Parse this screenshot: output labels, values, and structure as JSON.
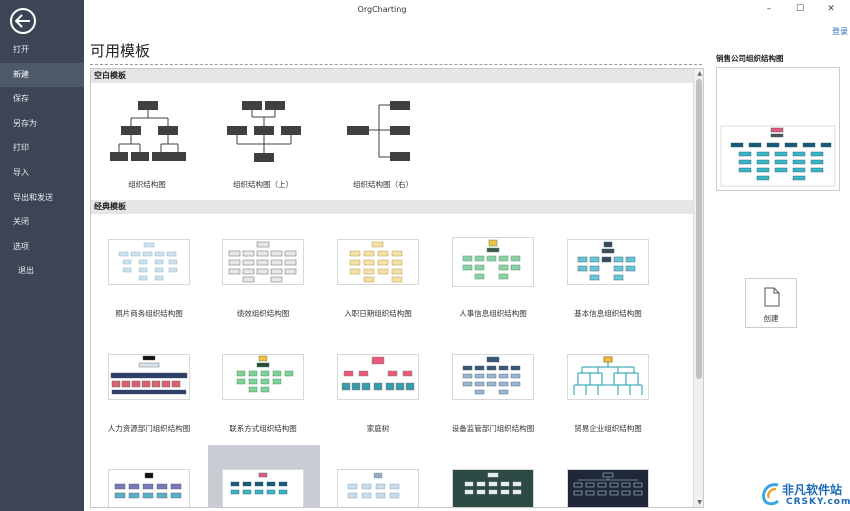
{
  "window": {
    "title": "OrgCharting",
    "minimize": "–",
    "maximize": "☐",
    "close": "✕",
    "login": "登录"
  },
  "sidebar": {
    "items": [
      {
        "label": "打开"
      },
      {
        "label": "新建"
      },
      {
        "label": "保存"
      },
      {
        "label": "另存为"
      },
      {
        "label": "打印"
      },
      {
        "label": "导入"
      },
      {
        "label": "导出和发送"
      },
      {
        "label": "关闭"
      },
      {
        "label": "选项"
      },
      {
        "label": "退出"
      }
    ]
  },
  "main": {
    "title": "可用模板",
    "sections": {
      "blank": "空白模板",
      "classic": "经典模板"
    },
    "blank_templates": [
      {
        "label": "组织结构图"
      },
      {
        "label": "组织结构图（上）"
      },
      {
        "label": "组织结构图（右）"
      }
    ],
    "classic_templates": [
      {
        "label": "照片商务组织结构图"
      },
      {
        "label": "绩效组织结构图"
      },
      {
        "label": "入职日期组织结构图"
      },
      {
        "label": "人事信息组织结构图"
      },
      {
        "label": "基本信息组织结构图"
      },
      {
        "label": "人力资源部门组织结构图"
      },
      {
        "label": "联系方式组织结构图"
      },
      {
        "label": "家庭树"
      },
      {
        "label": "设备监管部门组织结构图"
      },
      {
        "label": "贸易企业组织结构图"
      }
    ]
  },
  "preview": {
    "title": "销售公司组织结构图"
  },
  "create": {
    "label": "创建"
  },
  "watermark": {
    "line1": "非凡软件站",
    "line2": "CRSKY.com"
  },
  "colors": {
    "sidebar_bg": "#3b4555",
    "accent_link": "#2a6ebb",
    "section_bg": "#e6e6e6"
  }
}
